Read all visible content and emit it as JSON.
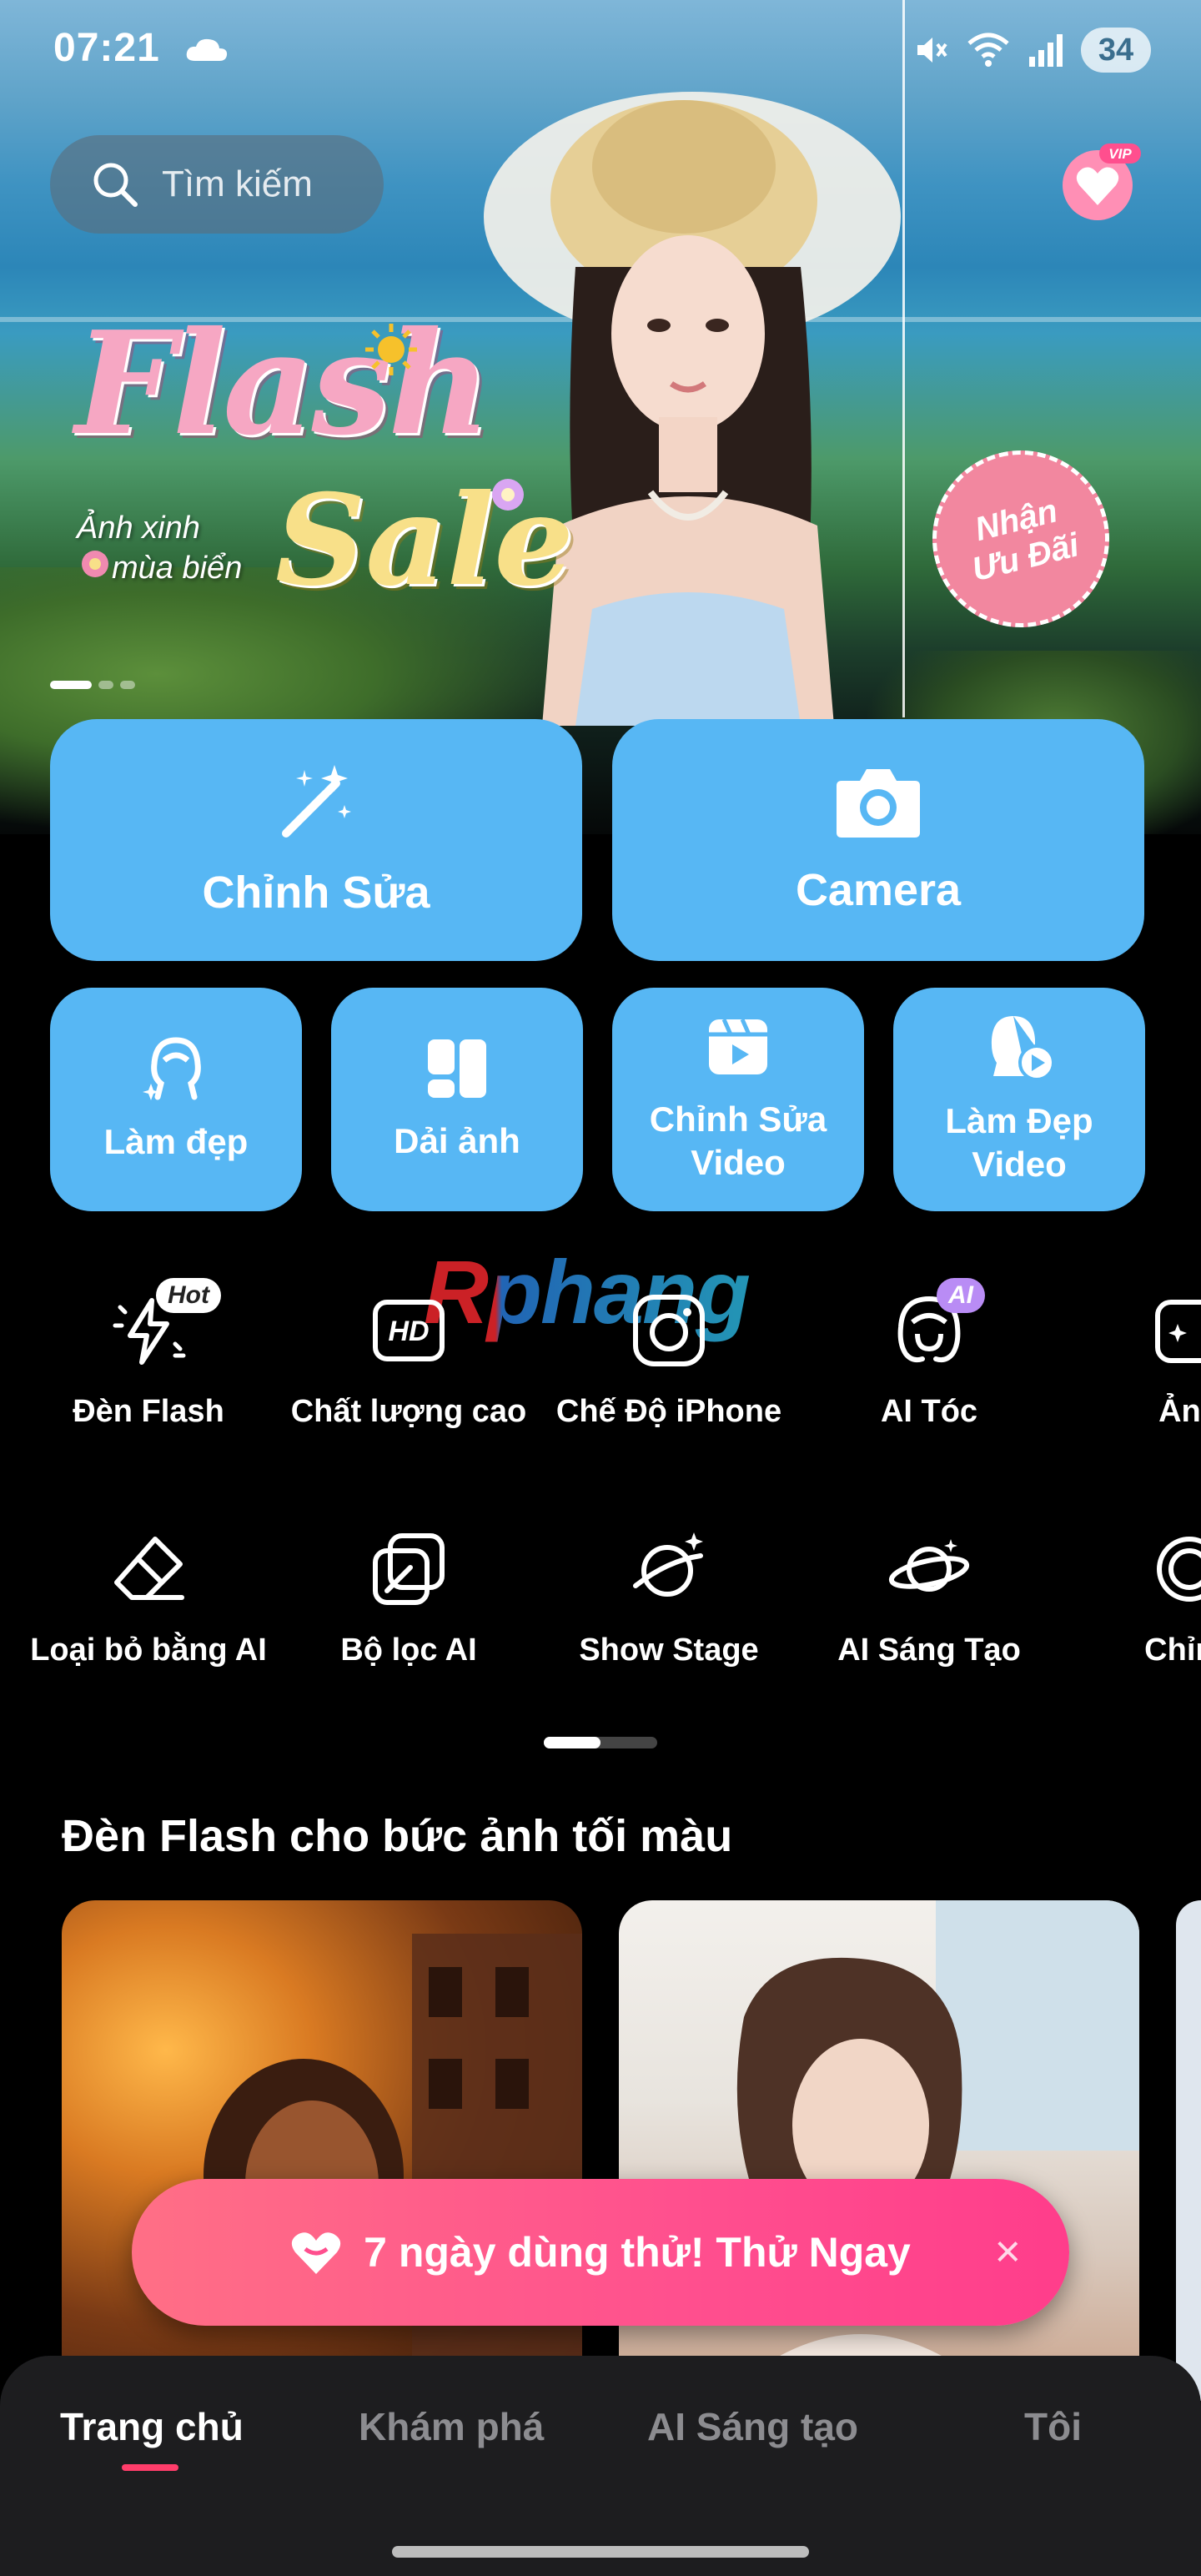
{
  "status_bar": {
    "time": "07:21",
    "battery": "34"
  },
  "search": {
    "placeholder": "Tìm kiếm"
  },
  "banner": {
    "title_1": "Flash",
    "title_2": "Sale",
    "subtitle_1": "Ảnh xinh",
    "subtitle_2": "mùa biển",
    "badge_line_1": "Nhận",
    "badge_line_2": "Ưu Đãi",
    "vip_label": "VIP"
  },
  "main_actions": [
    {
      "label": "Chỉnh Sửa",
      "icon": "magic-wand-icon"
    },
    {
      "label": "Camera",
      "icon": "camera-icon"
    }
  ],
  "secondary_actions": [
    {
      "label": "Làm đẹp",
      "icon": "beauty-face-icon"
    },
    {
      "label": "Dải ảnh",
      "icon": "collage-icon"
    },
    {
      "label": "Chỉnh Sửa Video",
      "icon": "video-edit-icon"
    },
    {
      "label": "Làm Đẹp Video",
      "icon": "video-beauty-icon"
    }
  ],
  "tools_row_1": [
    {
      "label": "Đèn Flash",
      "icon": "flash-icon",
      "tag": "Hot"
    },
    {
      "label": "Chất lượng cao",
      "icon": "hd-icon"
    },
    {
      "label": "Chế Độ iPhone",
      "icon": "iphone-camera-icon"
    },
    {
      "label": "AI Tóc",
      "icon": "ai-hair-icon",
      "tag": "AI"
    },
    {
      "label": "Ảnh",
      "icon": "photo-sparkle-icon"
    }
  ],
  "tools_row_2": [
    {
      "label": "Loại bỏ bằng AI",
      "icon": "eraser-icon"
    },
    {
      "label": "Bộ lọc AI",
      "icon": "ai-filter-icon"
    },
    {
      "label": "Show Stage",
      "icon": "show-stage-icon"
    },
    {
      "label": "AI Sáng Tạo",
      "icon": "planet-icon"
    },
    {
      "label": "Chỉnh",
      "icon": "ring-icon"
    }
  ],
  "watermark": "Rphang",
  "section": {
    "title": "Đèn Flash cho bức ảnh tối màu"
  },
  "trial_banner": {
    "text": "7 ngày dùng thử! Thử Ngay",
    "close": "×"
  },
  "bottom_nav": [
    {
      "label": "Trang chủ",
      "active": true
    },
    {
      "label": "Khám phá",
      "active": false
    },
    {
      "label": "AI Sáng tạo",
      "active": false
    },
    {
      "label": "Tôi",
      "active": false
    }
  ],
  "colors": {
    "accent_blue": "#57b7f4",
    "trial_pink": "#ff4f8e",
    "nav_active": "#ff3d6a"
  }
}
